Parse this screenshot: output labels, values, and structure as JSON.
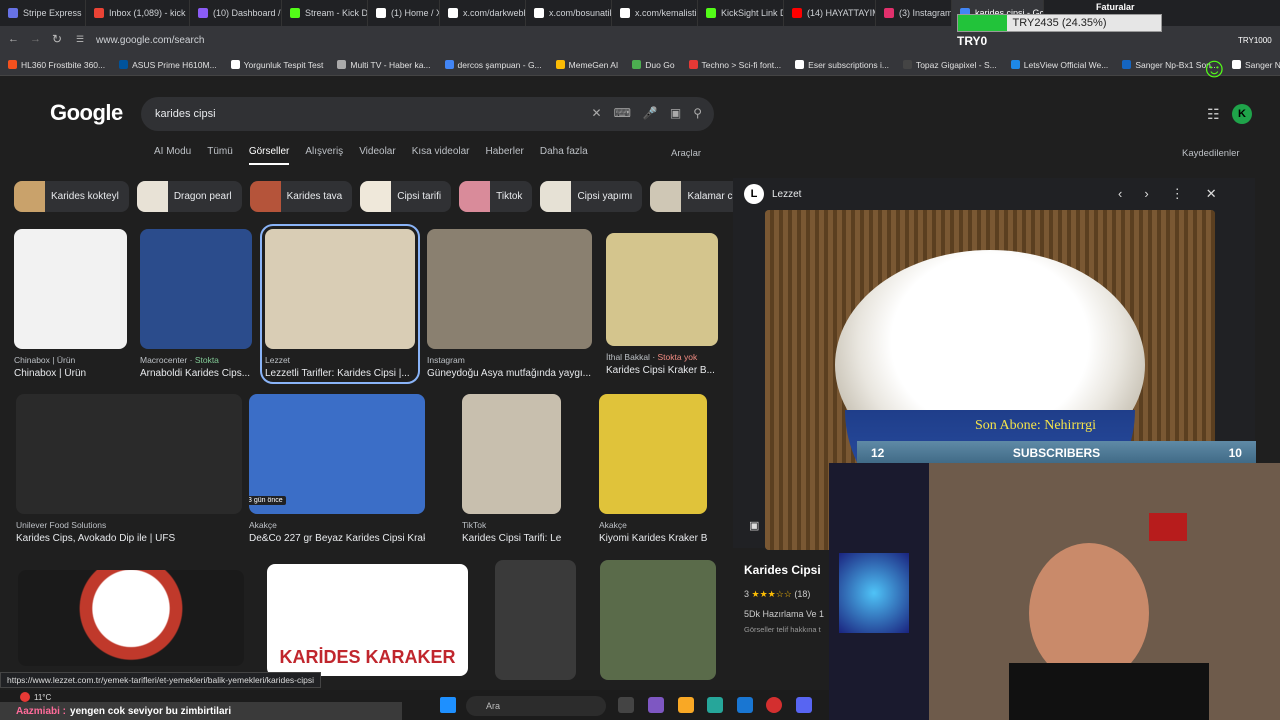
{
  "tabs": [
    {
      "label": "Stripe Express",
      "color": "#6772e5"
    },
    {
      "label": "Inbox (1,089) - kick",
      "color": "#ea4335"
    },
    {
      "label": "(10) Dashboard / S",
      "color": "#8b5cf6"
    },
    {
      "label": "Stream - Kick Dash",
      "color": "#53fc18"
    },
    {
      "label": "(1) Home / X",
      "color": "#ffffff"
    },
    {
      "label": "x.com/darkwebhab",
      "color": "#ffffff"
    },
    {
      "label": "x.com/bosunatik",
      "color": "#ffffff"
    },
    {
      "label": "x.com/kemalistika",
      "color": "#ffffff"
    },
    {
      "label": "KickSight Link Det",
      "color": "#53fc18"
    },
    {
      "label": "(14) HAYATTAYIM",
      "color": "#ff0000"
    },
    {
      "label": "(3) Instagram",
      "color": "#e1306c"
    },
    {
      "label": "karides cipsi - Google",
      "color": "#4285f4"
    }
  ],
  "address": {
    "url": "www.google.com/search"
  },
  "bookmarks": [
    {
      "label": "HL360 Frostbite 360...",
      "color": "#f4511e"
    },
    {
      "label": "ASUS Prime H610M...",
      "color": "#00539b"
    },
    {
      "label": "Yorgunluk Tespit Test",
      "color": "#ffffff"
    },
    {
      "label": "Multi TV - Haber ka...",
      "color": "#aaaaaa"
    },
    {
      "label": "dercos şampuan - G...",
      "color": "#4285f4"
    },
    {
      "label": "MemeGen AI",
      "color": "#fbbc05"
    },
    {
      "label": "Duo Go",
      "color": "#4caf50"
    },
    {
      "label": "Techno > Sci-fi font...",
      "color": "#e53935"
    },
    {
      "label": "Eser subscriptions i...",
      "color": "#ffffff"
    },
    {
      "label": "Topaz Gigapixel - S...",
      "color": "#444444"
    },
    {
      "label": "LetsView Official We...",
      "color": "#1e88e5"
    },
    {
      "label": "Sanger Np-Bx1 Son...",
      "color": "#1565c0"
    },
    {
      "label": "Sanger NP-BX1 Sa...",
      "color": "#ffffff"
    }
  ],
  "google": {
    "logo": "Google",
    "query": "karides cipsi"
  },
  "nav": {
    "items": [
      "AI Modu",
      "Tümü",
      "Görseller",
      "Alışveriş",
      "Videolar",
      "Kısa videolar",
      "Haberler",
      "Daha fazla"
    ],
    "tools": "Araçlar",
    "saved": "Kaydedilenler"
  },
  "chips": [
    "Karides kokteyl",
    "Dragon pearl",
    "Karides tava",
    "Cipsi tarifi",
    "Tiktok",
    "Cipsi yapımı",
    "Kalamar c"
  ],
  "results": [
    {
      "source": "Chinabox | Ürün",
      "stock": "",
      "title": "Chinabox | Ürün"
    },
    {
      "source": "Macrocenter",
      "stock": "Stokta",
      "title": "Arnaboldi Karides Cips..."
    },
    {
      "source": "Lezzet",
      "stock": "",
      "title": "Lezzetli Tarifler: Karides Cipsi |..."
    },
    {
      "source": "Instagram",
      "stock": "",
      "title": "Güneydoğu Asya mutfağında yaygı..."
    },
    {
      "source": "İthal Bakkal",
      "stock": "Stokta yok",
      "title": "Karides Cipsi Kraker B..."
    },
    {
      "source": "Unilever Food Solutions",
      "stock": "",
      "title": "Karides Cips, Avokado Dip ile | UFS"
    },
    {
      "source": "Akakçe",
      "stock": "",
      "title": "De&Co 227 gr Beyaz Karides Cipsi Kraker ..."
    },
    {
      "source": "TikTok",
      "stock": "",
      "title": "Karides Cipsi Tarifi: Lezz..."
    },
    {
      "source": "Akakçe",
      "stock": "",
      "title": "Kiyomi Karides Kraker Bey..."
    }
  ],
  "badge_3gun": "3 gün önce",
  "bottom_label": "KARİDES KARAKER",
  "panel": {
    "site": "Lezzet",
    "title": "Karides Cipsi",
    "rating": "3",
    "reviews": "(18)",
    "meta": "5Dk Hazırlama Ve 1",
    "copyright": "Görseller telif hakkına t"
  },
  "stream": {
    "goal": "TRY2435 (24.35%)",
    "goal_fraction": 0.2435,
    "try0": "TRY0",
    "faturalar": "Faturalar",
    "last_sub": "Son Abone: Nehirrrgi",
    "sub_left": "12",
    "sub_label": "SUBSCRIBERS",
    "sub_right": "10",
    "tryright": "TRY1000"
  },
  "status_url": "https://www.lezzet.com.tr/yemek-tarifleri/et-yemekleri/balik-yemekleri/karides-cipsi",
  "chat": {
    "user": "Aazmiabi :",
    "message": "yengen cok seviyor bu zimbirtilari"
  },
  "taskbar": {
    "search": "Ara",
    "temp": "11°C"
  }
}
